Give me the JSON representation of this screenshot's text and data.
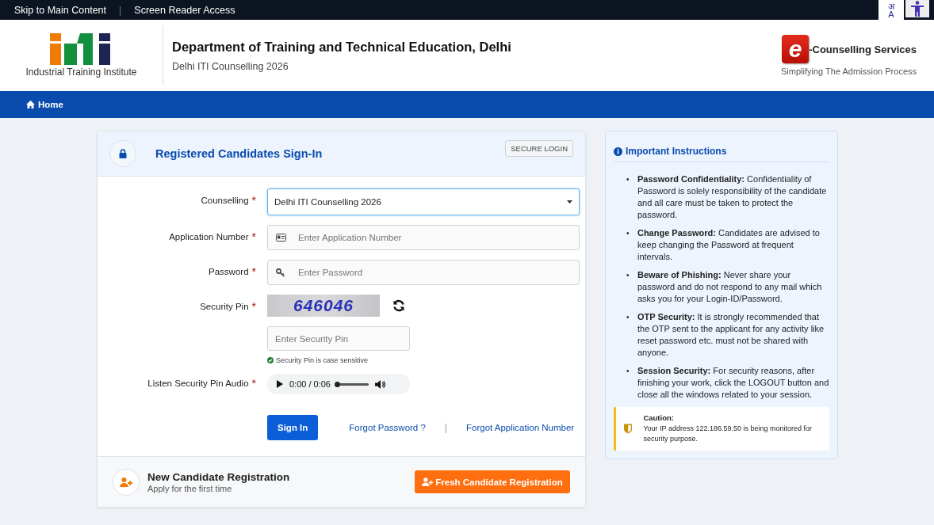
{
  "top_bar": {
    "links": [
      "Skip to Main Content",
      "Screen Reader Access"
    ],
    "separator": "|",
    "language_toggle": {
      "top": "अ",
      "bottom": "A"
    }
  },
  "header": {
    "logo_caption": "Industrial Training Institute",
    "title": "Department of Training and Technical Education, Delhi",
    "subtitle": "Delhi ITI Counselling 2026",
    "brand_letter": "e",
    "brand_name": "-Counselling Services",
    "brand_tagline": "Simplifying The Admission Process"
  },
  "nav": {
    "items": [
      {
        "label": "Home"
      }
    ]
  },
  "login": {
    "title": "Registered Candidates Sign-In",
    "badge": "SECURE LOGIN",
    "fields": [
      {
        "kind": "select",
        "label": "Counselling",
        "required_mark": "*",
        "value": "Delhi ITI Counselling 2026"
      },
      {
        "kind": "text",
        "label": "Application Number",
        "required_mark": "*",
        "placeholder": "Enter Application Number"
      },
      {
        "kind": "password",
        "label": "Password",
        "required_mark": "*",
        "placeholder": "Enter Password"
      },
      {
        "kind": "captcha",
        "label": "Security Pin",
        "required_mark": "*",
        "captcha": "646046",
        "placeholder": "Enter Security Pin",
        "hint": "Security Pin is case sensitive"
      },
      {
        "kind": "audio",
        "label": "Listen Security Pin Audio",
        "required_mark": "*",
        "time": "0:00 / 0:06",
        "level": 0
      }
    ],
    "sign_in": "Sign In",
    "links": [
      "Forgot Password ?",
      "Forgot Application Number"
    ],
    "links_separator": "|",
    "register": {
      "title": "New Candidate Registration",
      "subtitle": "Apply for the first time",
      "button": "Fresh Candidate Registration"
    }
  },
  "instructions": {
    "title": "Important Instructions",
    "bullet": "•",
    "items": [
      "**Password Confidentiality:** Confidentiality of Password is solely responsibility of the candidate and all care must be taken to protect the password.",
      "**Change Password:** Candidates are advised to keep changing the Password at frequent intervals.",
      "**Beware of Phishing:** Never share your password and do not respond to any mail which asks you for your Login-ID/Password.",
      "**OTP Security:** It is strongly recommended that the OTP sent to the applicant for any activity like reset password etc. must not be shared with anyone.",
      "**Session Security:** For security reasons, after finishing your work, click the LOGOUT button and close all the windows related to your session."
    ],
    "caution": {
      "title": "Caution:",
      "text": "Your IP address 122.186.59.50 is being monitored for security purpose."
    }
  }
}
